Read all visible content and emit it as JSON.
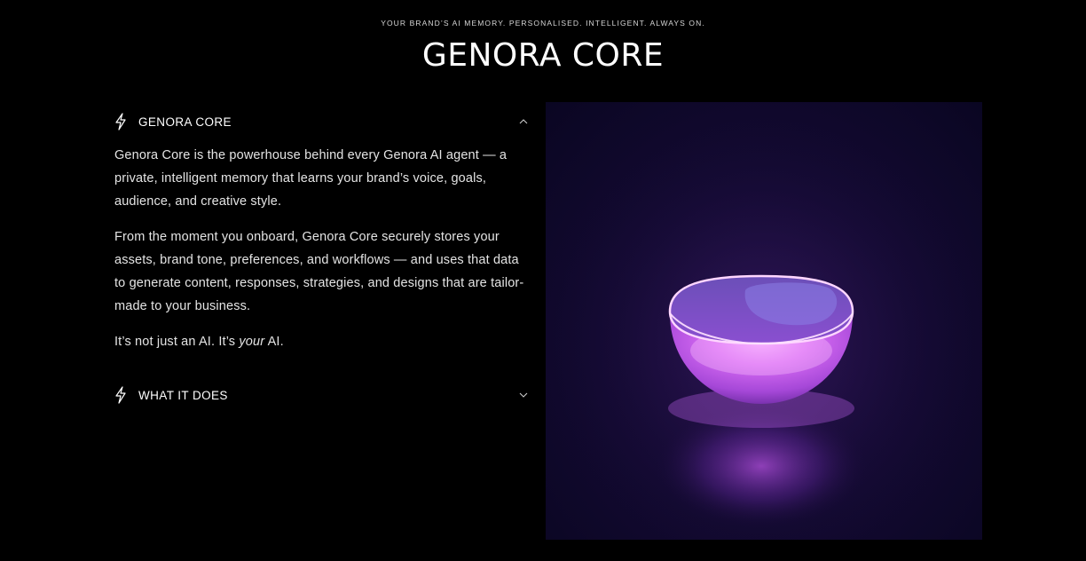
{
  "header": {
    "tagline": "YOUR BRAND’S AI MEMORY. PERSONALISED. INTELLIGENT. ALWAYS ON.",
    "title": "GENORA CORE"
  },
  "accordion": {
    "items": [
      {
        "label": "GENORA CORE",
        "expanded": true,
        "icon": "lightning-bolt-icon",
        "paragraphs": [
          "Genora Core is the powerhouse behind every Genora AI agent — a private, intelligent memory that learns your brand’s voice, goals, audience, and creative style.",
          "From the moment you onboard, Genora Core securely stores your assets, brand tone, preferences, and workflows — and uses that data to generate content, responses, strategies, and designs that are tailor-made to your business."
        ],
        "closing_a": "It’s not just an AI. It’s ",
        "closing_em": "your",
        "closing_b": " AI."
      },
      {
        "label": "WHAT IT DOES",
        "expanded": false,
        "icon": "lightning-bolt-icon"
      }
    ]
  },
  "colors": {
    "background": "#000000",
    "glow": "#c56cf0",
    "hero_bg": "#140a33"
  }
}
